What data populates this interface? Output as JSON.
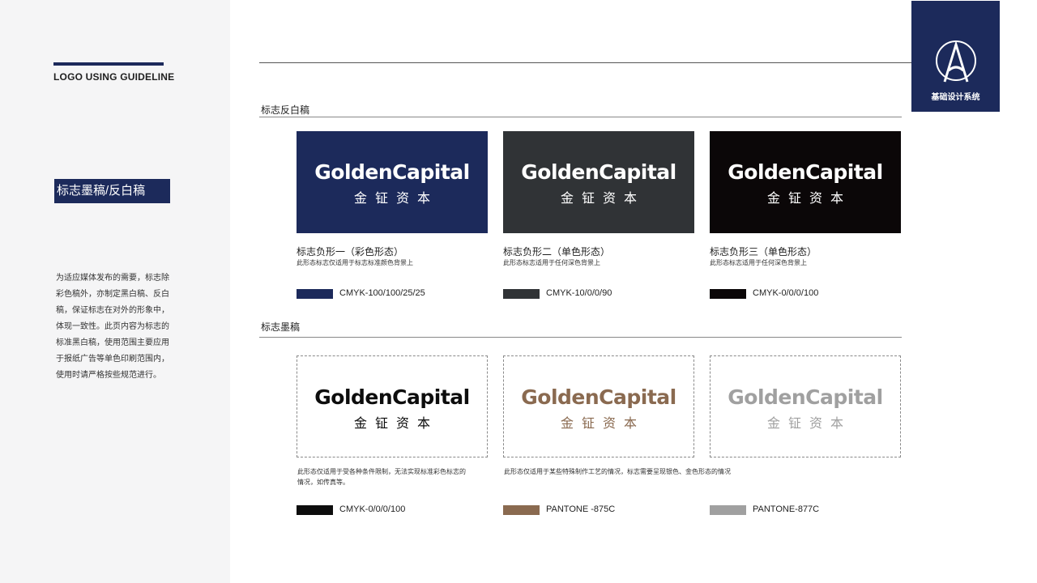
{
  "sidebar": {
    "title": "LOGO USING GUIDELINE",
    "section_tag": "标志墨稿/反白稿",
    "description": "为适应媒体发布的需要，标志除彩色稿外，亦制定黑白稿、反白稿，保证标志在对外的形象中，体现一致性。此页内容为标志的标准黑白稿，使用范围主要应用于报纸广告等单色印刷范围内，使用时请严格按些规范进行。"
  },
  "badge": {
    "label": "基础设计系统",
    "icon": "letter-a-circle-icon"
  },
  "logo": {
    "en": "GoldenCapital",
    "cn": "金钲资本"
  },
  "reverse_section": {
    "heading": "标志反白稿",
    "items": [
      {
        "bg": "#1c2a5b",
        "fg": "#ffffff",
        "title": "标志负形一（彩色形态）",
        "sub": "此形态标志仅适用于标志标准颜色背景上",
        "swatch_color": "#1c2a5b",
        "swatch_label": "CMYK-100/100/25/25"
      },
      {
        "bg": "#303336",
        "fg": "#ffffff",
        "title": "标志负形二（单色形态）",
        "sub": "此形态标志适用于任何深色背景上",
        "swatch_color": "#303336",
        "swatch_label": "CMYK-10/0/0/90"
      },
      {
        "bg": "#0b0708",
        "fg": "#ffffff",
        "title": "标志负形三（单色形态）",
        "sub": "此形态标志适用于任何深色背景上",
        "swatch_color": "#0b0708",
        "swatch_label": "CMYK-0/0/0/100"
      }
    ]
  },
  "ink_section": {
    "heading": "标志墨稿",
    "note_left": "此形态仅适用于受各种条件限制，无法实现标准彩色标志的情况，如传真等。",
    "note_middle": "此形态仅适用于某些特殊制作工艺的情况，标志需要呈现银色、金色形态的情况",
    "items": [
      {
        "fg": "#0d0d0d",
        "swatch_color": "#0d0d0d",
        "swatch_label": "CMYK-0/0/0/100"
      },
      {
        "fg": "#8a6a50",
        "swatch_color": "#8a6a50",
        "swatch_label": "PANTONE -875C"
      },
      {
        "fg": "#a0a0a0",
        "swatch_color": "#a0a0a0",
        "swatch_label": "PANTONE-877C"
      }
    ]
  }
}
